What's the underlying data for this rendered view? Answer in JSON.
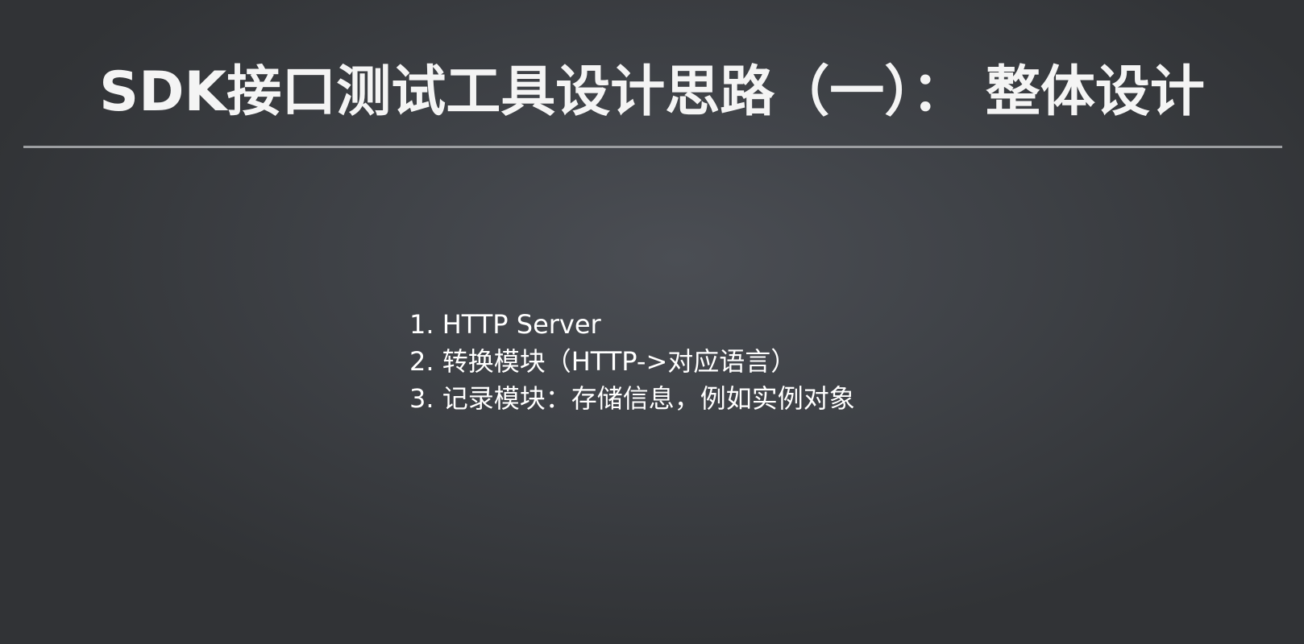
{
  "slide": {
    "title": "SDK接口测试工具设计思路（一）： 整体设计",
    "items": [
      "1. HTTP Server",
      "2. 转换模块（HTTP->对应语言）",
      "3. 记录模块：存储信息，例如实例对象"
    ]
  }
}
